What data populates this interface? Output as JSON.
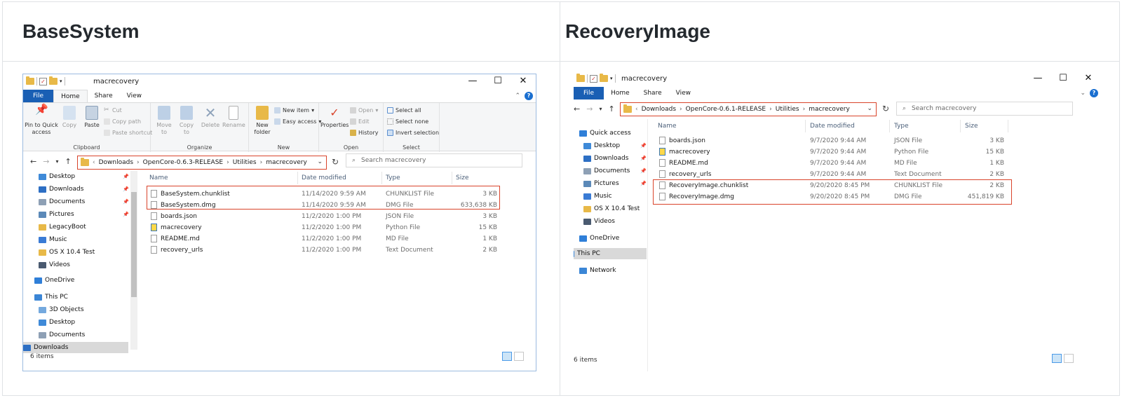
{
  "columns": {
    "left_title": "BaseSystem",
    "right_title": "RecoveryImage"
  },
  "colors": {
    "highlight": "#d9442b",
    "file_tab": "#1a5fb4",
    "selection": "#cce0f5"
  },
  "window_title": "macrecovery",
  "window_controls": {
    "minimize": "—",
    "maximize": "☐",
    "close": "✕"
  },
  "tabs": {
    "file": "File",
    "home": "Home",
    "share": "Share",
    "view": "View"
  },
  "ribbon": {
    "clipboard": {
      "pin": "Pin to Quick access",
      "copy": "Copy",
      "paste": "Paste",
      "cut": "Cut",
      "copy_path": "Copy path",
      "paste_shortcut": "Paste shortcut",
      "group": "Clipboard"
    },
    "organize": {
      "move_to": "Move to",
      "copy_to": "Copy to",
      "delete": "Delete",
      "rename": "Rename",
      "group": "Organize"
    },
    "new": {
      "new_folder": "New folder",
      "new_item": "New item",
      "easy_access": "Easy access",
      "group": "New"
    },
    "open": {
      "properties": "Properties",
      "open": "Open",
      "edit": "Edit",
      "history": "History",
      "group": "Open"
    },
    "select": {
      "select_all": "Select all",
      "select_none": "Select none",
      "invert": "Invert selection",
      "group": "Select"
    }
  },
  "left": {
    "breadcrumb": [
      "Downloads",
      "OpenCore-0.6.3-RELEASE",
      "Utilities",
      "macrecovery"
    ],
    "search_placeholder": "Search macrecovery",
    "nav": [
      {
        "label": "Desktop",
        "icon": "desktop-icon"
      },
      {
        "label": "Downloads",
        "icon": "downloads-icon"
      },
      {
        "label": "Documents",
        "icon": "documents-icon"
      },
      {
        "label": "Pictures",
        "icon": "pictures-icon"
      },
      {
        "label": "LegacyBoot",
        "icon": "folder-icon"
      },
      {
        "label": "Music",
        "icon": "music-icon"
      },
      {
        "label": "OS X 10.4 Test",
        "icon": "folder-icon"
      },
      {
        "label": "Videos",
        "icon": "videos-icon"
      },
      {
        "label": "OneDrive",
        "icon": "cloud-icon"
      },
      {
        "label": "This PC",
        "icon": "pc-icon"
      },
      {
        "label": "3D Objects",
        "icon": "3d-icon"
      },
      {
        "label": "Desktop",
        "icon": "desktop-icon"
      },
      {
        "label": "Documents",
        "icon": "documents-icon"
      },
      {
        "label": "Downloads",
        "icon": "downloads-icon"
      }
    ],
    "headers": {
      "name": "Name",
      "date": "Date modified",
      "type": "Type",
      "size": "Size"
    },
    "files": [
      {
        "name": "BaseSystem.chunklist",
        "date": "11/14/2020 9:59 AM",
        "type": "CHUNKLIST File",
        "size": "3 KB"
      },
      {
        "name": "BaseSystem.dmg",
        "date": "11/14/2020 9:59 AM",
        "type": "DMG File",
        "size": "633,638 KB"
      },
      {
        "name": "boards.json",
        "date": "11/2/2020 1:00 PM",
        "type": "JSON File",
        "size": "3 KB"
      },
      {
        "name": "macrecovery",
        "date": "11/2/2020 1:00 PM",
        "type": "Python File",
        "size": "15 KB"
      },
      {
        "name": "README.md",
        "date": "11/2/2020 1:00 PM",
        "type": "MD File",
        "size": "1 KB"
      },
      {
        "name": "recovery_urls",
        "date": "11/2/2020 1:00 PM",
        "type": "Text Document",
        "size": "2 KB"
      }
    ],
    "status": "6 items"
  },
  "right": {
    "breadcrumb": [
      "Downloads",
      "OpenCore-0.6.1-RELEASE",
      "Utilities",
      "macrecovery"
    ],
    "search_placeholder": "Search macrecovery",
    "nav": [
      {
        "label": "Quick access",
        "icon": "star-icon"
      },
      {
        "label": "Desktop",
        "icon": "desktop-icon"
      },
      {
        "label": "Downloads",
        "icon": "downloads-icon"
      },
      {
        "label": "Documents",
        "icon": "documents-icon"
      },
      {
        "label": "Pictures",
        "icon": "pictures-icon"
      },
      {
        "label": "Music",
        "icon": "music-icon"
      },
      {
        "label": "OS X 10.4 Test",
        "icon": "folder-icon"
      },
      {
        "label": "Videos",
        "icon": "videos-icon"
      },
      {
        "label": "OneDrive",
        "icon": "cloud-icon"
      },
      {
        "label": "This PC",
        "icon": "pc-icon"
      },
      {
        "label": "Network",
        "icon": "network-icon"
      }
    ],
    "headers": {
      "name": "Name",
      "date": "Date modified",
      "type": "Type",
      "size": "Size"
    },
    "files": [
      {
        "name": "boards.json",
        "date": "9/7/2020 9:44 AM",
        "type": "JSON File",
        "size": "3 KB"
      },
      {
        "name": "macrecovery",
        "date": "9/7/2020 9:44 AM",
        "type": "Python File",
        "size": "15 KB"
      },
      {
        "name": "README.md",
        "date": "9/7/2020 9:44 AM",
        "type": "MD File",
        "size": "1 KB"
      },
      {
        "name": "recovery_urls",
        "date": "9/7/2020 9:44 AM",
        "type": "Text Document",
        "size": "2 KB"
      },
      {
        "name": "RecoveryImage.chunklist",
        "date": "9/20/2020 8:45 PM",
        "type": "CHUNKLIST File",
        "size": "2 KB"
      },
      {
        "name": "RecoveryImage.dmg",
        "date": "9/20/2020 8:45 PM",
        "type": "DMG File",
        "size": "451,819 KB"
      }
    ],
    "status": "6 items"
  }
}
